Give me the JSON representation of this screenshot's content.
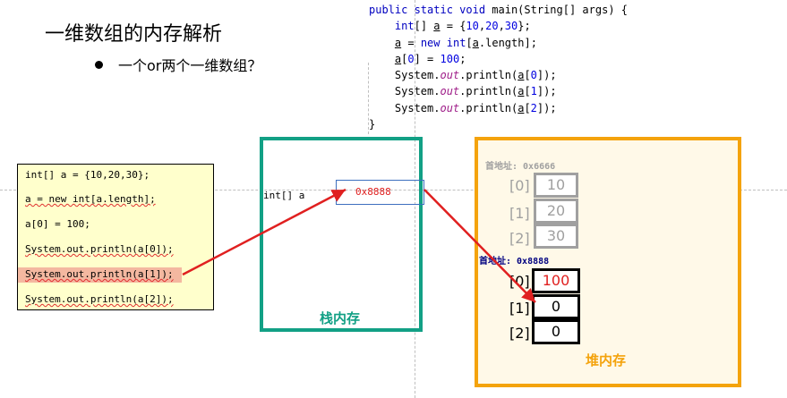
{
  "title": "一维数组的内存解析",
  "bullet": "一个or两个一维数组？",
  "code_lines": {
    "l1_kw": "public static void",
    "l1_rest": " main(String[] args) {",
    "l2_kw": "int",
    "l2_a": "[] ",
    "l2_var": "a",
    "l2_b": " = {",
    "l2_n1": "10",
    "l2_c": ",",
    "l2_n2": "20",
    "l2_d": ",",
    "l2_n3": "30",
    "l2_e": "};",
    "l3_var": "a",
    "l3_a": " = ",
    "l3_kw1": "new",
    "l3_b": " ",
    "l3_kw2": "int",
    "l3_c": "[",
    "l3_var2": "a",
    "l3_d": ".length];",
    "l4_var": "a",
    "l4_a": "[",
    "l4_n": "0",
    "l4_b": "] = ",
    "l4_n2": "100",
    "l4_c": ";",
    "l5_a": "System.",
    "l5_out": "out",
    "l5_b": ".println(",
    "l5_var": "a",
    "l5_c": "[",
    "l5_n": "0",
    "l5_d": "]);",
    "l6_a": "System.",
    "l6_out": "out",
    "l6_b": ".println(",
    "l6_var": "a",
    "l6_c": "[",
    "l6_n": "1",
    "l6_d": "]);",
    "l7_a": "System.",
    "l7_out": "out",
    "l7_b": ".println(",
    "l7_var": "a",
    "l7_c": "[",
    "l7_n": "2",
    "l7_d": "]);",
    "l8": "}"
  },
  "left_code": [
    "int[] a = {10,20,30};",
    "a = new int[a.length];",
    "a[0] = 100;",
    "System.out.println(a[0]);",
    "System.out.println(a[1]);",
    "System.out.println(a[2]);"
  ],
  "stack": {
    "label": "栈内存",
    "var_name": "int[] a",
    "ref_value": "0x8888"
  },
  "heap": {
    "label": "堆内存",
    "old_array": {
      "address_label": "首地址: 0x6666",
      "indices": [
        "[0]",
        "[1]",
        "[2]"
      ],
      "values": [
        "10",
        "20",
        "30"
      ]
    },
    "new_array": {
      "address_label": "首地址: 0x8888",
      "indices": [
        "[0]",
        "[1]",
        "[2]"
      ],
      "values": [
        "100",
        "0",
        "0"
      ]
    }
  },
  "colors": {
    "stack_border": "#12a085",
    "heap_border": "#f4a30c",
    "arrow": "#e02020",
    "code_keyword": "#0000c0"
  }
}
